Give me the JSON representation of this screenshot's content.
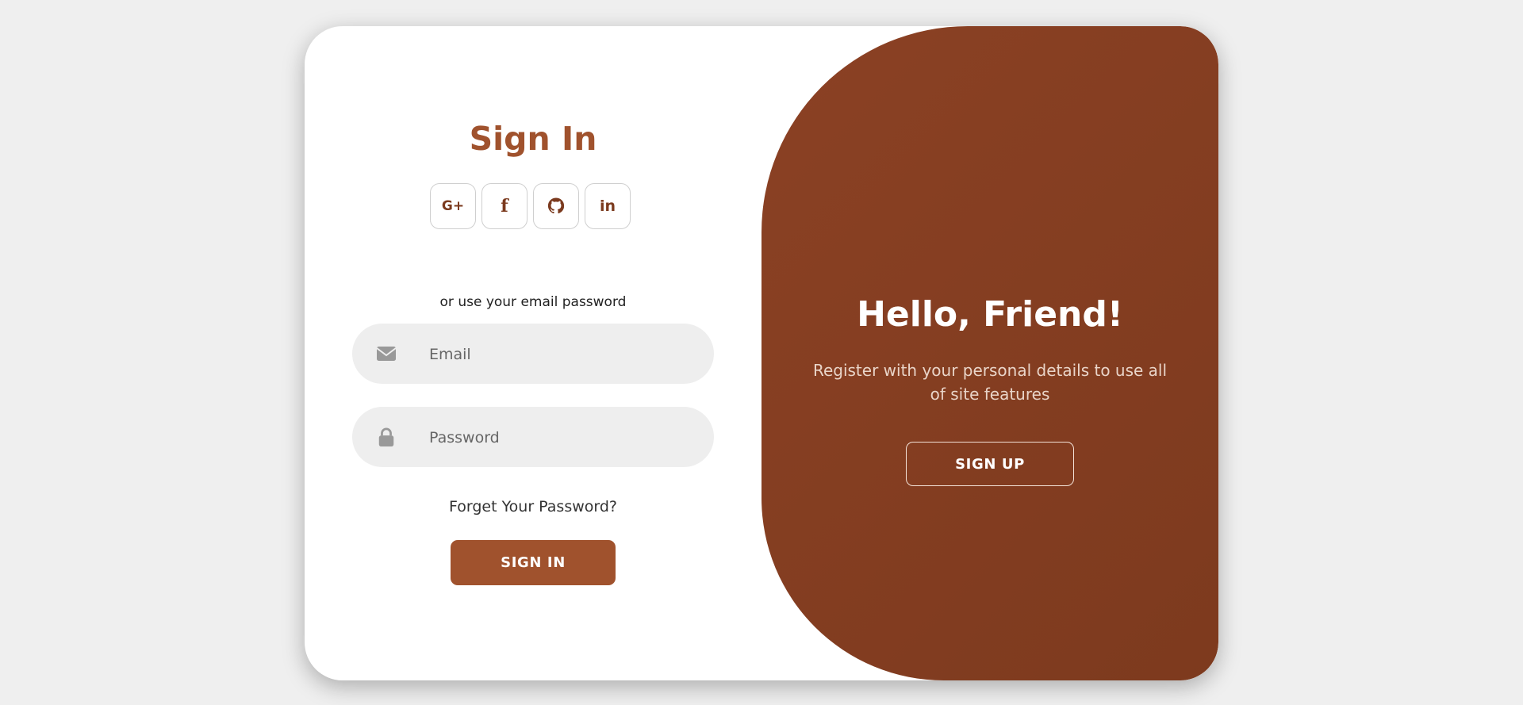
{
  "signin": {
    "title": "Sign In",
    "social_buttons": [
      {
        "label": "G+",
        "icon": "google-plus-icon"
      },
      {
        "label": "f",
        "icon": "facebook-icon"
      },
      {
        "label": "github",
        "icon": "github-icon"
      },
      {
        "label": "in",
        "icon": "linkedin-icon"
      }
    ],
    "or_text": "or use your email password",
    "email": {
      "placeholder": "Email",
      "icon": "envelope-icon"
    },
    "password": {
      "placeholder": "Password",
      "icon": "lock-icon"
    },
    "forget_text": "Forget Your Password?",
    "signin_label": "SIGN IN"
  },
  "panel": {
    "title": "Hello, Friend!",
    "description": "Register with your personal details to use all of site features",
    "signup_label": "SIGN UP"
  },
  "colors": {
    "accent": "#a0522d",
    "panel": "#8b4124",
    "background": "#efefef"
  }
}
